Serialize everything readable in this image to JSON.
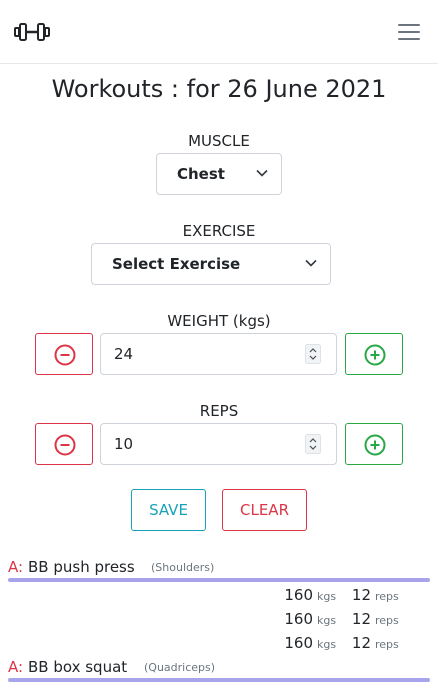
{
  "header": {
    "logo_icon": "dumbbell-icon",
    "menu_icon": "hamburger-menu-icon"
  },
  "title": "Workouts : for 26 June 2021",
  "muscle": {
    "label": "MUSCLE",
    "selected": "Chest"
  },
  "exercise": {
    "label": "EXERCISE",
    "selected": "Select Exercise"
  },
  "weight": {
    "label": "WEIGHT (kgs)",
    "value": "24"
  },
  "reps": {
    "label": "REPS",
    "value": "10"
  },
  "actions": {
    "save": "SAVE",
    "clear": "CLEAR"
  },
  "colors": {
    "minus": "#dc3545",
    "plus": "#28a745",
    "save": "#17a2b8",
    "divider": "#a8a4ec"
  },
  "log": [
    {
      "tag": "A:",
      "name": "BB push press",
      "muscle": "(Shoulders)",
      "sets": [
        {
          "weight": "160",
          "weight_unit": "kgs",
          "reps": "12",
          "reps_unit": "reps"
        },
        {
          "weight": "160",
          "weight_unit": "kgs",
          "reps": "12",
          "reps_unit": "reps"
        },
        {
          "weight": "160",
          "weight_unit": "kgs",
          "reps": "12",
          "reps_unit": "reps"
        }
      ]
    },
    {
      "tag": "A:",
      "name": "BB box squat",
      "muscle": "(Quadriceps)",
      "sets": []
    }
  ]
}
